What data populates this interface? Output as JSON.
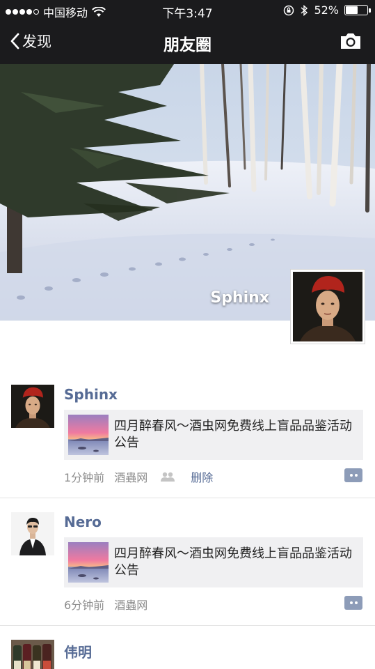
{
  "status_bar": {
    "carrier": "中国移动",
    "time": "下午3:47",
    "battery_text": "52%",
    "battery_level": 0.52,
    "signal_bars_filled": 4,
    "signal_bars_total": 5,
    "icons": [
      "signal-dots-icon",
      "wifi-icon",
      "rotation-lock-icon",
      "bluetooth-icon",
      "battery-icon"
    ]
  },
  "nav": {
    "back_label": "发现",
    "title": "朋友圈",
    "camera_icon": "camera-icon"
  },
  "cover": {
    "owner_name": "Sphinx"
  },
  "posts": [
    {
      "author": "Sphinx",
      "link_title": "四月醉春风～酒虫网免费线上盲品品鉴活动公告",
      "time": "1分钟前",
      "source": "酒蟲网",
      "delete_label": "删除",
      "has_friends_icon": true
    },
    {
      "author": "Nero",
      "link_title": "四月醉春风～酒虫网免费线上盲品品鉴活动公告",
      "time": "6分钟前",
      "source": "酒蟲网"
    },
    {
      "author": "伟明"
    }
  ],
  "colors": {
    "nav_bg": "#1b1b1d",
    "name_link": "#566b95",
    "card_bg": "#f0f0f2",
    "meta_gray": "#8c8c8c",
    "comment_button": "#8d9cb8"
  }
}
